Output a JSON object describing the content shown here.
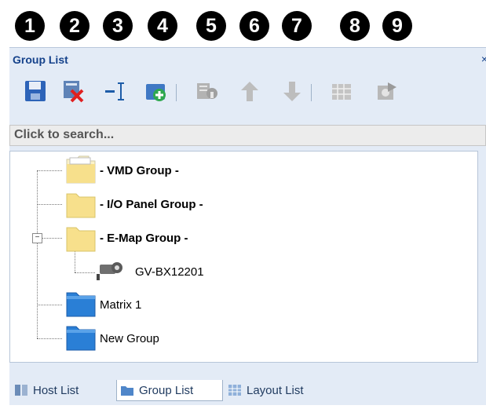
{
  "callouts": [
    "1",
    "2",
    "3",
    "4",
    "5",
    "6",
    "7",
    "8",
    "9"
  ],
  "panel": {
    "title": "Group List",
    "close_glyph": "×"
  },
  "toolbar": {
    "buttons": [
      {
        "name": "save-icon"
      },
      {
        "name": "delete-icon"
      },
      {
        "name": "rename-icon"
      },
      {
        "name": "add-group-icon"
      },
      {
        "name": "properties-icon"
      },
      {
        "name": "move-up-icon"
      },
      {
        "name": "move-down-icon"
      },
      {
        "name": "layout-icon"
      },
      {
        "name": "export-icon"
      }
    ]
  },
  "search": {
    "placeholder": "Click to search..."
  },
  "tree": {
    "items": [
      {
        "label": "- VMD Group -",
        "bold": true,
        "icon": "folder-open-icon"
      },
      {
        "label": "- I/O Panel Group -",
        "bold": true,
        "icon": "folder-icon"
      },
      {
        "label": "- E-Map Group -",
        "bold": true,
        "icon": "folder-icon",
        "expander": "⊟"
      },
      {
        "label": "GV-BX12201",
        "bold": false,
        "icon": "camera-icon"
      },
      {
        "label": "Matrix 1",
        "bold": false,
        "icon": "blue-folder-icon"
      },
      {
        "label": "New Group",
        "bold": false,
        "icon": "blue-folder-icon"
      }
    ]
  },
  "tabs": [
    {
      "label": "Host List",
      "active": false
    },
    {
      "label": "Group List",
      "active": true
    },
    {
      "label": "Layout List",
      "active": false
    }
  ],
  "colors": {
    "panel_bg": "#e3ebf6",
    "title_text": "#15428b",
    "folder_yellow": "#f7e08c",
    "folder_blue": "#2a7fd6"
  }
}
